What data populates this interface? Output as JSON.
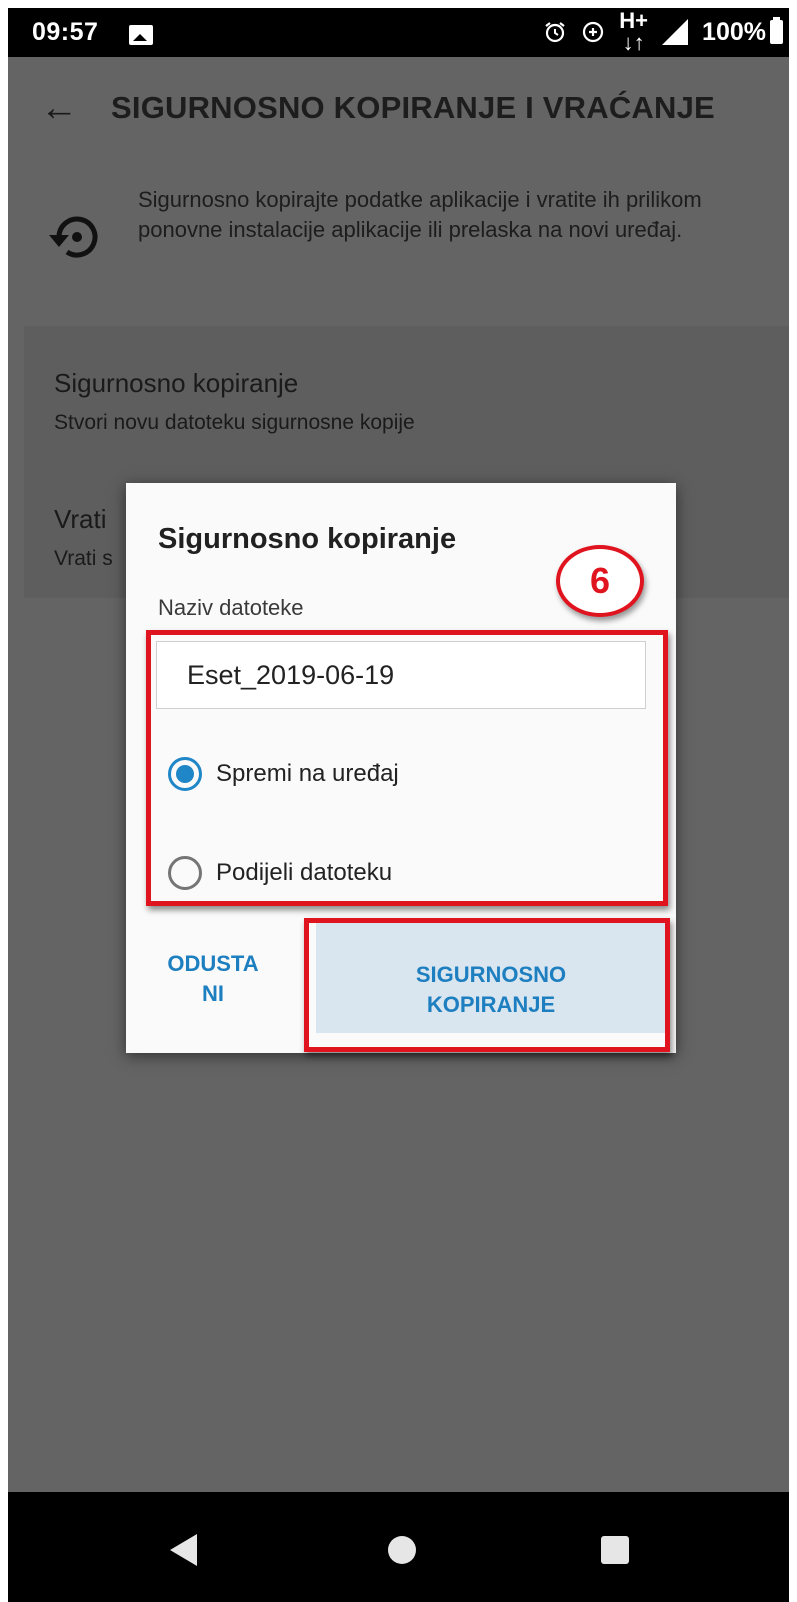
{
  "status_bar": {
    "time": "09:57",
    "network": "H+",
    "battery": "100%",
    "icons": [
      "image-icon",
      "alarm-icon",
      "data-saver-icon",
      "network-type-icon",
      "signal-icon",
      "battery-icon"
    ]
  },
  "app_bar": {
    "title": "SIGURNOSNO KOPIRANJE I VRAĆANJE"
  },
  "intro": {
    "text": "Sigurnosno kopirajte podatke aplikacije i vratite ih prilikom ponovne instalacije aplikacije ili prelaska na novi uređaj."
  },
  "settings": {
    "backup": {
      "title": "Sigurnosno kopiranje",
      "subtitle": "Stvori novu datoteku sigurnosne kopije"
    },
    "restore": {
      "title": "Vrati",
      "subtitle": "Vrati s"
    }
  },
  "dialog": {
    "title": "Sigurnosno kopiranje",
    "filename_label": "Naziv datoteke",
    "filename_value": "Eset_2019-06-19",
    "options": [
      {
        "label": "Spremi na uređaj",
        "selected": true
      },
      {
        "label": "Podijeli datoteku",
        "selected": false
      }
    ],
    "cancel_line1": "ODUSTA",
    "cancel_line2": "NI",
    "confirm_line1": "SIGURNOSNO",
    "confirm_line2": "KOPIRANJE"
  },
  "annotation": {
    "step_number": "6",
    "color": "#e0141e"
  },
  "colors": {
    "accent": "#1e7fc0",
    "scrim": "#646464",
    "dialog_bg": "#fafafa"
  }
}
